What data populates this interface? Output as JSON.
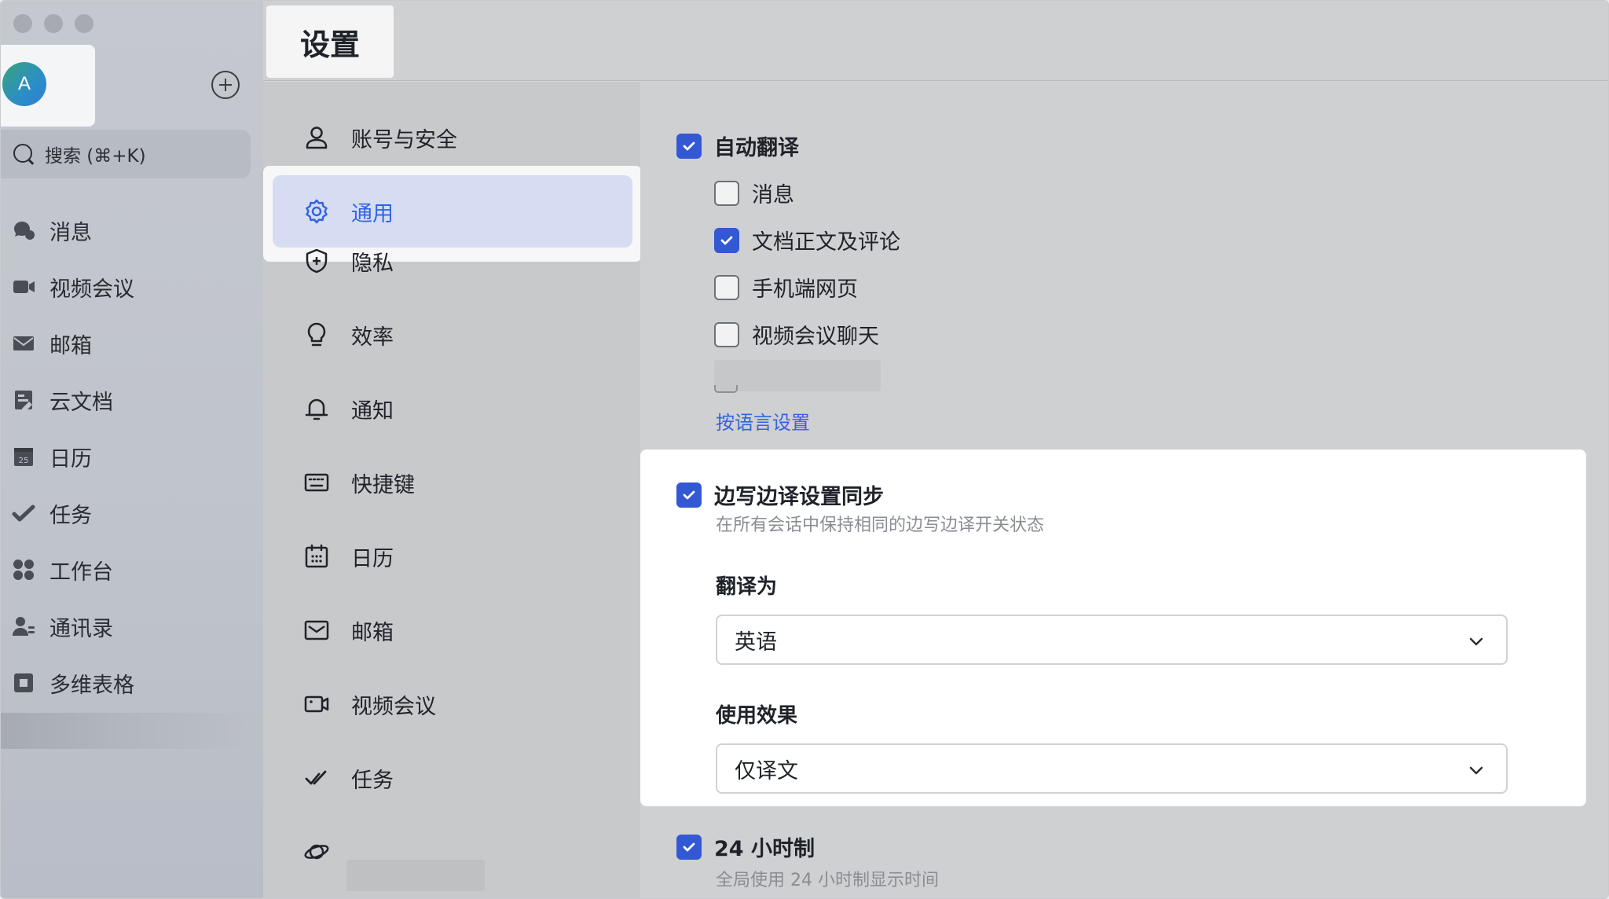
{
  "window": {
    "title": "设置"
  },
  "app_sidebar": {
    "avatar_initial": "A",
    "search_placeholder": "搜索 (⌘+K)",
    "items": [
      {
        "label": "消息",
        "icon": "chat-bubble-icon"
      },
      {
        "label": "视频会议",
        "icon": "video-camera-icon"
      },
      {
        "label": "邮箱",
        "icon": "mail-icon"
      },
      {
        "label": "云文档",
        "icon": "document-icon"
      },
      {
        "label": "日历",
        "icon": "calendar-icon",
        "badge": "25"
      },
      {
        "label": "任务",
        "icon": "checkmark-icon"
      },
      {
        "label": "工作台",
        "icon": "grid-icon"
      },
      {
        "label": "通讯录",
        "icon": "contacts-icon"
      },
      {
        "label": "多维表格",
        "icon": "table-icon"
      }
    ]
  },
  "settings_nav": {
    "items": [
      {
        "label": "账号与安全",
        "icon": "user-icon"
      },
      {
        "label": "通用",
        "icon": "gear-icon",
        "active": true
      },
      {
        "label": "隐私",
        "icon": "shield-icon"
      },
      {
        "label": "效率",
        "icon": "lightbulb-icon"
      },
      {
        "label": "通知",
        "icon": "bell-icon"
      },
      {
        "label": "快捷键",
        "icon": "keyboard-icon"
      },
      {
        "label": "日历",
        "icon": "calendar-icon"
      },
      {
        "label": "邮箱",
        "icon": "mail-icon"
      },
      {
        "label": "视频会议",
        "icon": "video-camera-icon"
      },
      {
        "label": "任务",
        "icon": "checkmark-icon"
      },
      {
        "label": "",
        "icon": "planet-icon"
      }
    ]
  },
  "content": {
    "auto_translate": {
      "label": "自动翻译",
      "checked": true
    },
    "auto_translate_options": [
      {
        "label": "消息",
        "checked": false
      },
      {
        "label": "文档正文及评论",
        "checked": true
      },
      {
        "label": "手机端网页",
        "checked": false
      },
      {
        "label": "视频会议聊天",
        "checked": false
      }
    ],
    "by_language_link": "按语言设置",
    "sync": {
      "label": "边写边译设置同步",
      "checked": true,
      "description": "在所有会话中保持相同的边写边译开关状态"
    },
    "translate_to": {
      "label": "翻译为",
      "value": "英语"
    },
    "effect": {
      "label": "使用效果",
      "value": "仅译文"
    },
    "clock24": {
      "label": "24 小时制",
      "checked": true,
      "description": "全局使用 24 小时制显示时间"
    }
  },
  "colors": {
    "accent": "#3364e0",
    "checkbox": "#3358d4",
    "active_bg": "#d6ddf3"
  }
}
